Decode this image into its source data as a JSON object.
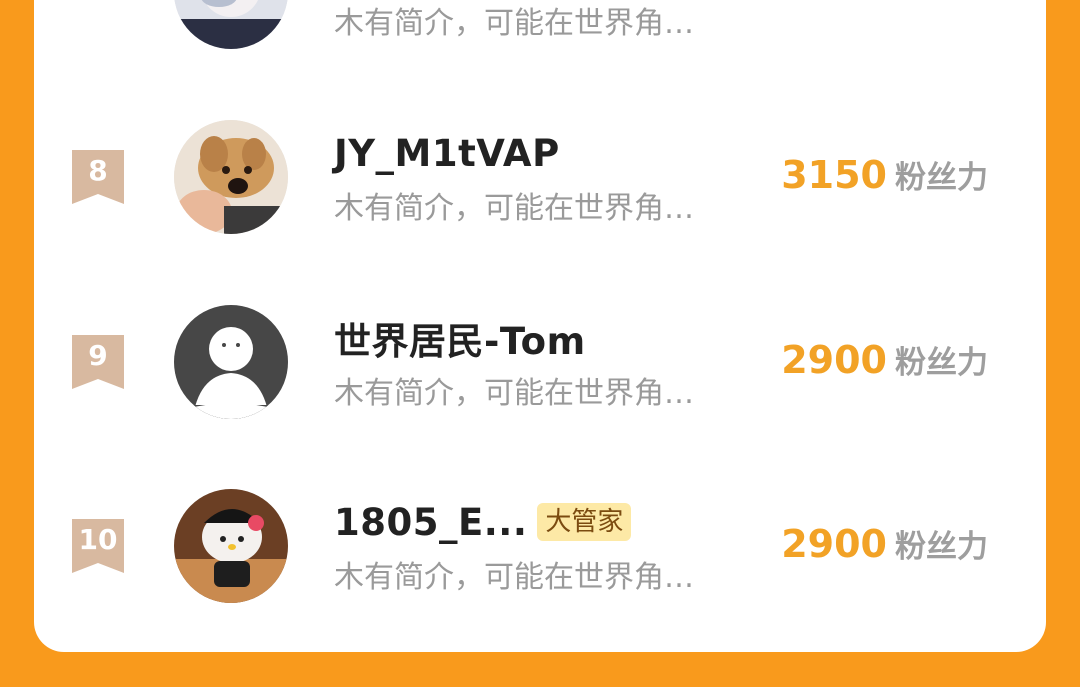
{
  "colors": {
    "background": "#f99a1c",
    "card": "#ffffff",
    "rank_badge": "#d8b9a0",
    "score": "#f2a226",
    "unit": "#9e9e9e",
    "tag_bg": "#fde9a6"
  },
  "rankings": [
    {
      "rank": "",
      "name": "",
      "bio": "木有简介，可能在世界角…",
      "score": "",
      "unit": "",
      "tag": "",
      "avatar_icon": "avatar-photo-icon"
    },
    {
      "rank": "8",
      "name": "JY_M1tVAP",
      "bio": "木有简介，可能在世界角…",
      "score": "3150",
      "unit": "粉丝力",
      "tag": "",
      "avatar_icon": "dog-photo-icon"
    },
    {
      "rank": "9",
      "name": "世界居民-Tom",
      "bio": "木有简介，可能在世界角…",
      "score": "2900",
      "unit": "粉丝力",
      "tag": "",
      "avatar_icon": "default-user-icon"
    },
    {
      "rank": "10",
      "name": "1805_E...",
      "bio": "木有简介，可能在世界角…",
      "score": "2900",
      "unit": "粉丝力",
      "tag": "大管家",
      "avatar_icon": "character-photo-icon"
    }
  ]
}
